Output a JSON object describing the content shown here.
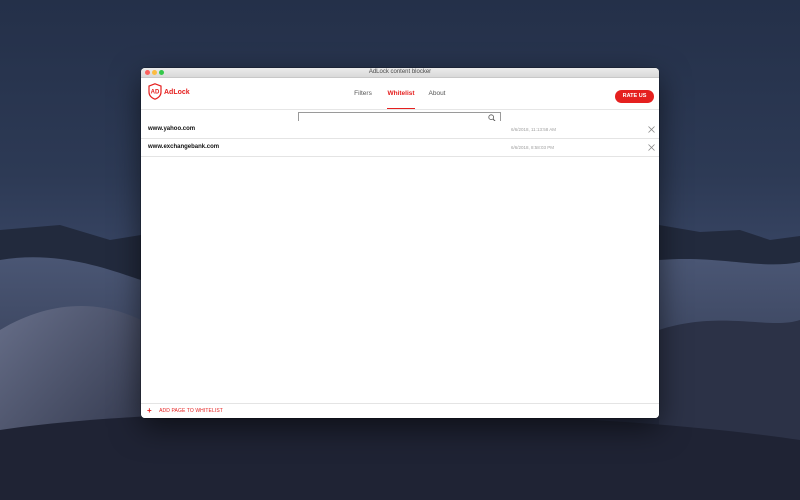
{
  "window": {
    "title": "AdLock content blocker"
  },
  "app": {
    "name": "AdLock",
    "brand_color": "#e5201f"
  },
  "nav": {
    "tabs": [
      {
        "label": "Filters",
        "active": false
      },
      {
        "label": "Whitelist",
        "active": true
      },
      {
        "label": "About",
        "active": false
      }
    ],
    "rate_label": "RATE US"
  },
  "search": {
    "value": "",
    "icon": "search-icon"
  },
  "whitelist": {
    "items": [
      {
        "domain": "www.yahoo.com",
        "time": "6/6/2018, 11:13:58 AM"
      },
      {
        "domain": "www.exchangebank.com",
        "time": "6/6/2018, 8:58:03 PM"
      }
    ]
  },
  "footer": {
    "add_label": "ADD PAGE TO WHITELIST",
    "add_icon": "plus-icon"
  }
}
